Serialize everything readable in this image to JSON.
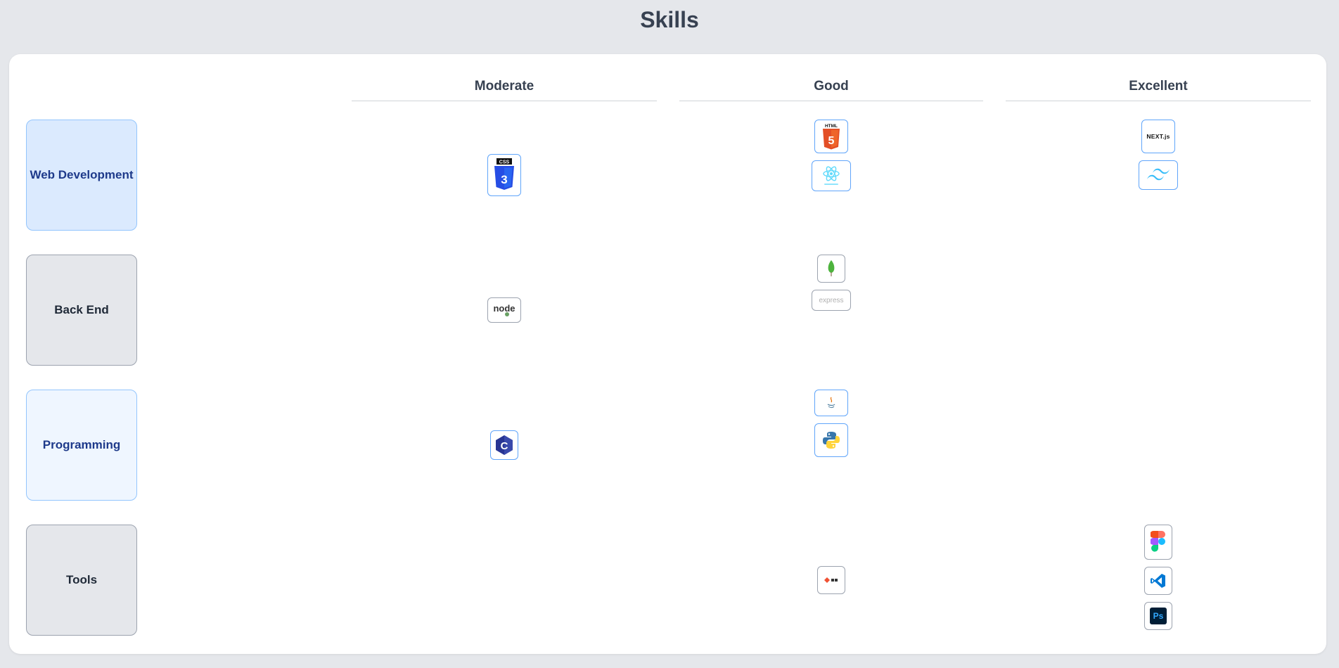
{
  "page": {
    "title": "Skills"
  },
  "columns": [
    "Moderate",
    "Good",
    "Excellent"
  ],
  "categories": [
    {
      "name": "Web Development",
      "style": "blue"
    },
    {
      "name": "Back End",
      "style": "gray"
    },
    {
      "name": "Programming",
      "style": "lightblue"
    },
    {
      "name": "Tools",
      "style": "gray"
    }
  ],
  "skills": {
    "web": {
      "moderate": [
        {
          "icon": "css3-icon"
        }
      ],
      "good": [
        {
          "icon": "html5-icon"
        },
        {
          "icon": "react-native-icon"
        }
      ],
      "excellent": [
        {
          "icon": "nextjs-icon",
          "text": "NEXT.js"
        },
        {
          "icon": "tailwind-icon"
        }
      ]
    },
    "backend": {
      "moderate": [
        {
          "icon": "nodejs-icon",
          "text": "node"
        }
      ],
      "good": [
        {
          "icon": "mongodb-icon"
        },
        {
          "icon": "express-icon",
          "text": "express"
        }
      ],
      "excellent": []
    },
    "programming": {
      "moderate": [
        {
          "icon": "c-language-icon"
        }
      ],
      "good": [
        {
          "icon": "java-icon"
        },
        {
          "icon": "python-icon"
        }
      ],
      "excellent": []
    },
    "tools": {
      "moderate": [],
      "good": [
        {
          "icon": "git-icon"
        }
      ],
      "excellent": [
        {
          "icon": "figma-icon"
        },
        {
          "icon": "vscode-icon"
        },
        {
          "icon": "photoshop-icon",
          "text": "Ps"
        }
      ]
    }
  },
  "colors": {
    "background": "#e5e7eb",
    "card": "#ffffff",
    "accent_blue": "#60a5fa",
    "category_blue": "#dbeafe"
  }
}
